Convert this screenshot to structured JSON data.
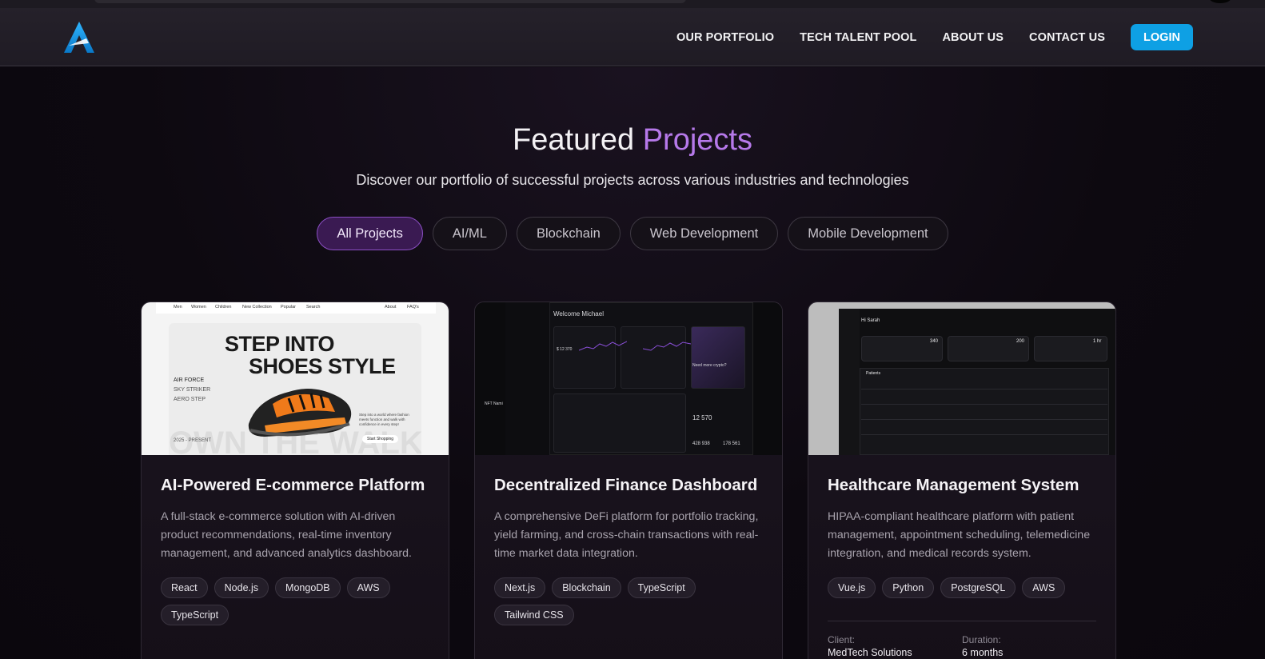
{
  "brand": {
    "logo": "a-logo-icon",
    "accent_color": "#0ea0e4"
  },
  "nav": {
    "items": [
      "OUR PORTFOLIO",
      "TECH TALENT POOL",
      "ABOUT US",
      "CONTACT US"
    ],
    "login_label": "LOGIN"
  },
  "section": {
    "title_main": "Featured",
    "title_accent": "Projects",
    "subtitle": "Discover our portfolio of successful projects across various industries and technologies",
    "accent_color": "#b679ea"
  },
  "filters": {
    "items": [
      "All Projects",
      "AI/ML",
      "Blockchain",
      "Web Development",
      "Mobile Development"
    ],
    "active": "All Projects"
  },
  "projects": [
    {
      "title": "AI-Powered E-commerce Platform",
      "description": "A full-stack e-commerce solution with AI-driven product recommendations, real-time inventory management, and advanced analytics dashboard.",
      "tags": [
        "React",
        "Node.js",
        "MongoDB",
        "AWS",
        "TypeScript"
      ],
      "thumbnail": {
        "nav": [
          "Men",
          "Women",
          "Children",
          "New Collection",
          "Popular",
          "Search",
          "About",
          "FAQ's"
        ],
        "headline_1": "STEP INTO",
        "headline_2": "SHOES STYLE",
        "side_labels": [
          "AIR FORCE",
          "SKY STRIKER",
          "AERO STEP"
        ],
        "years": "2025 - PRESENT",
        "tagline": "Step into a world where fashion meets function and walk with confidence in every step!",
        "cta": "Start Shopping",
        "watermark": "OWN THE WALK"
      }
    },
    {
      "title": "Decentralized Finance Dashboard",
      "description": "A comprehensive DeFi platform for portfolio tracking, yield farming, and cross-chain transactions with real-time market data integration.",
      "tags": [
        "Next.js",
        "Blockchain",
        "TypeScript",
        "Tailwind CSS"
      ],
      "thumbnail": {
        "welcome": "Welcome Michael",
        "big_number": "12 570",
        "bottom_value": "428 938",
        "bottom_value_2": "178 561",
        "side_label": "NFT Nami",
        "cta": "Need more crypto?",
        "price": "$ 12 370"
      }
    },
    {
      "title": "Healthcare Management System",
      "description": "HIPAA-compliant healthcare platform with patient management, appointment scheduling, telemedicine integration, and medical records system.",
      "tags": [
        "Vue.js",
        "Python",
        "PostgreSQL",
        "AWS"
      ],
      "client_label": "Client:",
      "client": "MedTech Solutions",
      "duration_label": "Duration:",
      "duration": "6 months",
      "thumbnail": {
        "greeting": "Hi Sarah",
        "stats": [
          "340",
          "200",
          "1 hr"
        ],
        "table_title": "Patients"
      }
    }
  ]
}
